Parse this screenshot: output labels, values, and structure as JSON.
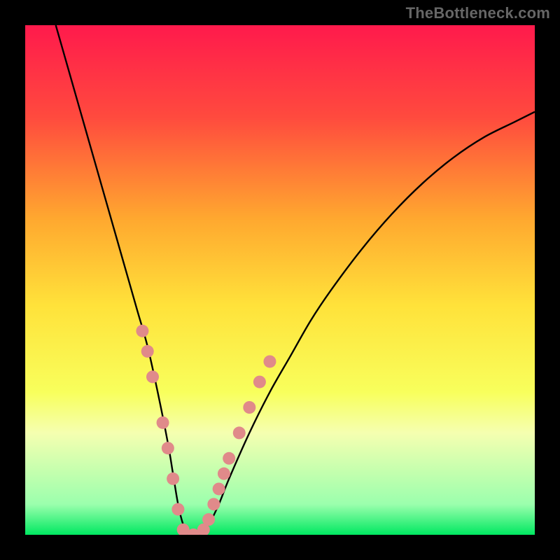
{
  "watermark": "TheBottleneck.com",
  "chart_data": {
    "type": "line",
    "title": "",
    "xlabel": "",
    "ylabel": "",
    "xlim": [
      0,
      100
    ],
    "ylim": [
      0,
      100
    ],
    "background_gradient": {
      "stops": [
        {
          "offset": 0,
          "color": "#ff1a4c"
        },
        {
          "offset": 18,
          "color": "#ff4a3e"
        },
        {
          "offset": 38,
          "color": "#ffa82f"
        },
        {
          "offset": 55,
          "color": "#ffe23a"
        },
        {
          "offset": 72,
          "color": "#f8ff5c"
        },
        {
          "offset": 80,
          "color": "#f5ffb0"
        },
        {
          "offset": 94,
          "color": "#9bffad"
        },
        {
          "offset": 100,
          "color": "#00e861"
        }
      ]
    },
    "series": [
      {
        "name": "bottleneck-curve",
        "color": "#000000",
        "x": [
          6,
          8,
          10,
          12,
          14,
          16,
          18,
          20,
          22,
          24,
          26,
          28,
          29,
          30,
          31,
          32,
          34,
          36,
          38,
          40,
          44,
          48,
          52,
          56,
          60,
          66,
          72,
          78,
          84,
          90,
          96,
          100
        ],
        "y": [
          100,
          93,
          86,
          79,
          72,
          65,
          58,
          51,
          44,
          37,
          28,
          18,
          12,
          6,
          2,
          0,
          0,
          2,
          6,
          11,
          20,
          28,
          35,
          42,
          48,
          56,
          63,
          69,
          74,
          78,
          81,
          83
        ]
      }
    ],
    "markers": {
      "name": "highlight-dots",
      "color": "#e08a8a",
      "radius_px": 9,
      "points": [
        {
          "x": 23,
          "y": 40
        },
        {
          "x": 24,
          "y": 36
        },
        {
          "x": 25,
          "y": 31
        },
        {
          "x": 27,
          "y": 22
        },
        {
          "x": 28,
          "y": 17
        },
        {
          "x": 29,
          "y": 11
        },
        {
          "x": 30,
          "y": 5
        },
        {
          "x": 31,
          "y": 1
        },
        {
          "x": 33,
          "y": 0
        },
        {
          "x": 35,
          "y": 1
        },
        {
          "x": 36,
          "y": 3
        },
        {
          "x": 37,
          "y": 6
        },
        {
          "x": 38,
          "y": 9
        },
        {
          "x": 39,
          "y": 12
        },
        {
          "x": 40,
          "y": 15
        },
        {
          "x": 42,
          "y": 20
        },
        {
          "x": 44,
          "y": 25
        },
        {
          "x": 46,
          "y": 30
        },
        {
          "x": 48,
          "y": 34
        }
      ]
    }
  }
}
